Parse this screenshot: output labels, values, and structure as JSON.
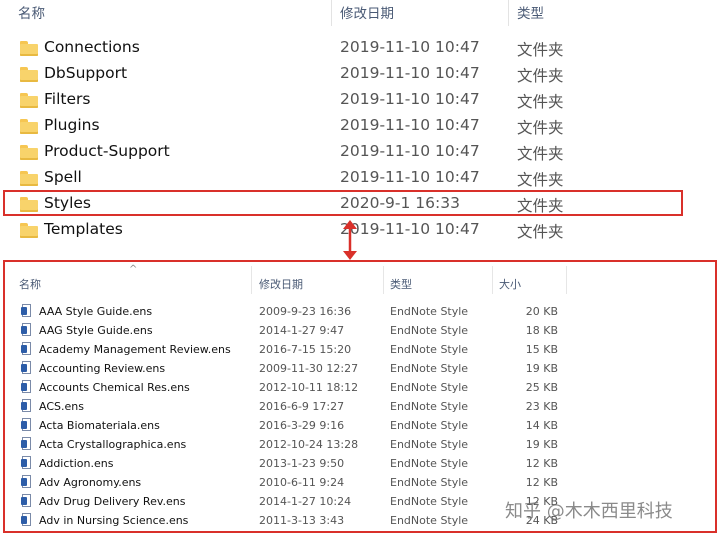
{
  "top_panel": {
    "columns": {
      "name": "名称",
      "date": "修改日期",
      "type": "类型"
    },
    "rows": [
      {
        "name": "Connections",
        "date": "2019-11-10 10:47",
        "type": "文件夹"
      },
      {
        "name": "DbSupport",
        "date": "2019-11-10 10:47",
        "type": "文件夹"
      },
      {
        "name": "Filters",
        "date": "2019-11-10 10:47",
        "type": "文件夹"
      },
      {
        "name": "Plugins",
        "date": "2019-11-10 10:47",
        "type": "文件夹"
      },
      {
        "name": "Product-Support",
        "date": "2019-11-10 10:47",
        "type": "文件夹"
      },
      {
        "name": "Spell",
        "date": "2019-11-10 10:47",
        "type": "文件夹"
      },
      {
        "name": "Styles",
        "date": "2020-9-1 16:33",
        "type": "文件夹"
      },
      {
        "name": "Templates",
        "date": "2019-11-10 10:47",
        "type": "文件夹"
      }
    ]
  },
  "bottom_panel": {
    "columns": {
      "name": "名称",
      "date": "修改日期",
      "type": "类型",
      "size": "大小"
    },
    "sort_indicator": "^",
    "rows": [
      {
        "name": "AAA Style Guide.ens",
        "date": "2009-9-23 16:36",
        "type": "EndNote Style",
        "size": "20 KB"
      },
      {
        "name": "AAG Style Guide.ens",
        "date": "2014-1-27 9:47",
        "type": "EndNote Style",
        "size": "18 KB"
      },
      {
        "name": "Academy Management Review.ens",
        "date": "2016-7-15 15:20",
        "type": "EndNote Style",
        "size": "15 KB"
      },
      {
        "name": "Accounting Review.ens",
        "date": "2009-11-30 12:27",
        "type": "EndNote Style",
        "size": "19 KB"
      },
      {
        "name": "Accounts Chemical Res.ens",
        "date": "2012-10-11 18:12",
        "type": "EndNote Style",
        "size": "25 KB"
      },
      {
        "name": "ACS.ens",
        "date": "2016-6-9 17:27",
        "type": "EndNote Style",
        "size": "23 KB"
      },
      {
        "name": "Acta Biomateriala.ens",
        "date": "2016-3-29 9:16",
        "type": "EndNote Style",
        "size": "14 KB"
      },
      {
        "name": "Acta Crystallographica.ens",
        "date": "2012-10-24 13:28",
        "type": "EndNote Style",
        "size": "19 KB"
      },
      {
        "name": "Addiction.ens",
        "date": "2013-1-23 9:50",
        "type": "EndNote Style",
        "size": "12 KB"
      },
      {
        "name": "Adv Agronomy.ens",
        "date": "2010-6-11 9:24",
        "type": "EndNote Style",
        "size": "12 KB"
      },
      {
        "name": "Adv Drug Delivery Rev.ens",
        "date": "2014-1-27 10:24",
        "type": "EndNote Style",
        "size": "12 KB"
      },
      {
        "name": "Adv in Nursing Science.ens",
        "date": "2011-3-13 3:43",
        "type": "EndNote Style",
        "size": "24 KB"
      }
    ]
  },
  "watermark": "知乎 @木木西里科技",
  "colors": {
    "highlight": "#d9302a",
    "folder": "#f8d36b",
    "header_text": "#4a5a75"
  },
  "icons": {
    "folder": "folder-icon",
    "file": "endnote-style-file-icon",
    "connector": "double-arrow-icon"
  }
}
